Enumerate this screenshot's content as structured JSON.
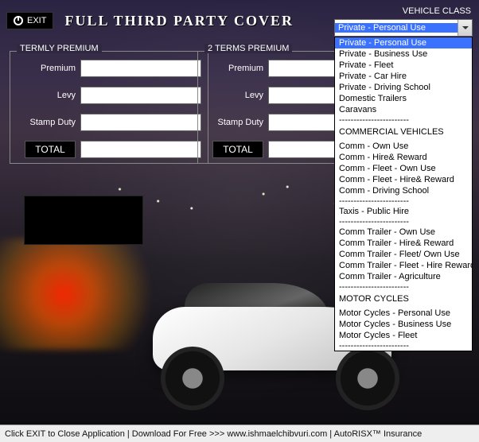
{
  "header": {
    "exit_label": "EXIT",
    "title": "FULL THIRD PARTY COVER"
  },
  "labels": {
    "premium": "Premium",
    "levy": "Levy",
    "stamp_duty": "Stamp Duty",
    "total": "TOTAL"
  },
  "termly": {
    "legend": "TERMLY PREMIUM",
    "premium": "",
    "levy": "",
    "stamp_duty": "",
    "total": ""
  },
  "two_terms": {
    "legend": "2 TERMS PREMIUM",
    "premium": "",
    "levy": "",
    "stamp_duty": "",
    "total": ""
  },
  "vehicle_class": {
    "label": "VEHICLE CLASS",
    "selected": "Private - Personal Use",
    "groups": [
      {
        "header": null,
        "items": [
          "Private - Personal Use",
          "Private - Business Use",
          "Private - Fleet",
          "Private - Car Hire",
          "Private - Driving School",
          "Domestic Trailers",
          "Caravans"
        ]
      },
      {
        "header": "COMMERCIAL VEHICLES",
        "items": [
          "Comm - Own Use",
          "Comm - Hire& Reward",
          "Comm - Fleet - Own Use",
          "Comm - Fleet - Hire& Reward",
          "Comm - Driving School"
        ]
      },
      {
        "header": null,
        "items": [
          "Taxis - Public Hire"
        ]
      },
      {
        "header": null,
        "items": [
          "Comm Trailer - Own Use",
          "Comm Trailer - Hire& Reward",
          "Comm Trailer - Fleet/ Own Use",
          "Comm Trailer - Fleet - Hire Reward",
          "Comm Trailer - Agriculture"
        ]
      },
      {
        "header": "MOTOR CYCLES",
        "items": [
          "Motor Cycles - Personal Use",
          "Motor Cycles - Business Use",
          "Motor Cycles - Fleet"
        ]
      }
    ],
    "separator": "------------------------"
  },
  "footer": {
    "text": "Click EXIT to Close Application  |  Download For Free  >>>  www.ishmaelchibvuri.com | AutoRISX™ Insurance"
  }
}
